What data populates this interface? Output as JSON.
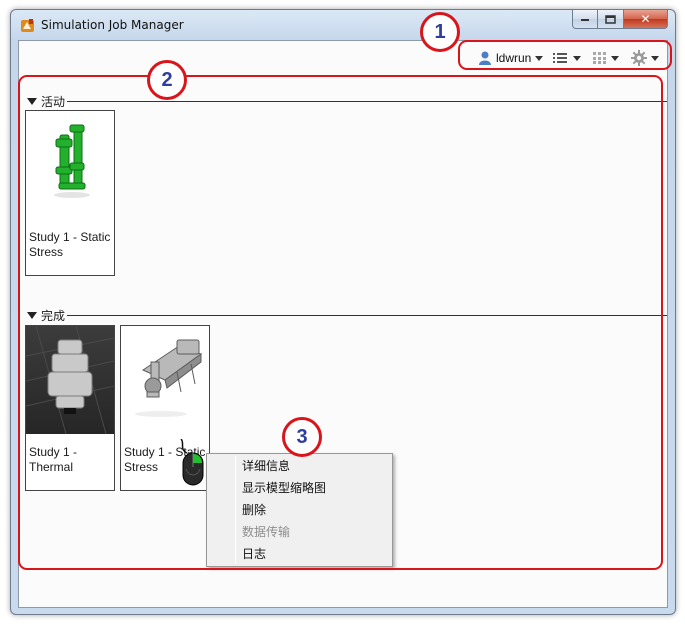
{
  "window": {
    "title": "Simulation Job Manager",
    "close_glyph": "✕"
  },
  "toolbar": {
    "user_label": "ldwrun",
    "icons": [
      "user-icon",
      "list-view-icon",
      "grid-view-icon",
      "settings-gear-icon"
    ]
  },
  "groups": [
    {
      "label": "活动",
      "tiles": [
        {
          "title": "Study 1 - Static Stress"
        }
      ]
    },
    {
      "label": "完成",
      "tiles": [
        {
          "title": "Study 1 - Thermal"
        },
        {
          "title": "Study 1 - Static Stress"
        }
      ]
    }
  ],
  "context_menu": {
    "items": [
      {
        "label": "详细信息",
        "enabled": true
      },
      {
        "label": "显示模型缩略图",
        "enabled": true
      },
      {
        "label": "删除",
        "enabled": true
      },
      {
        "label": "数据传输",
        "enabled": false
      },
      {
        "label": "日志",
        "enabled": true
      }
    ]
  },
  "callouts": [
    "1",
    "2",
    "3"
  ],
  "colors": {
    "callout": "#d9141b",
    "callout_number": "#2f3d9e",
    "accent_green": "#1fa52b"
  }
}
